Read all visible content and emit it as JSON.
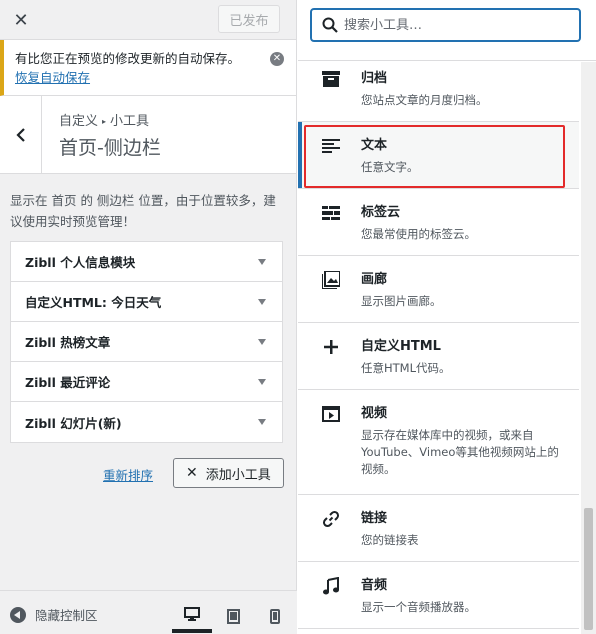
{
  "topbar": {
    "close": "✕",
    "publish_label": "已发布"
  },
  "notice": {
    "text": "有比您正在预览的修改更新的自动保存。",
    "link": "恢复自动保存"
  },
  "section": {
    "breadcrumb_parent": "自定义",
    "breadcrumb_child": "小工具",
    "title": "首页-侧边栏"
  },
  "description": "显示在 首页 的 侧边栏 位置，由于位置较多，建议使用实时预览管理！",
  "widgets": [
    {
      "label": "Zibll 个人信息模块"
    },
    {
      "label": "自定义HTML: 今日天气"
    },
    {
      "label": "Zibll 热榜文章"
    },
    {
      "label": "Zibll 最近评论"
    },
    {
      "label": "Zibll 幻灯片(新)"
    }
  ],
  "actions": {
    "reorder": "重新排序",
    "add": "添加小工具"
  },
  "footer": {
    "collapse": "隐藏控制区",
    "devices": [
      "desktop-icon",
      "tablet-icon",
      "mobile-icon"
    ],
    "active_device": "desktop"
  },
  "search": {
    "placeholder": "搜索小工具…",
    "value": ""
  },
  "available": [
    {
      "icon": "archive-icon",
      "title": "归档",
      "desc": "您站点文章的月度归档。"
    },
    {
      "icon": "text-icon",
      "title": "文本",
      "desc": "任意文字。",
      "selected": true
    },
    {
      "icon": "tag-cloud-icon",
      "title": "标签云",
      "desc": "您最常使用的标签云。"
    },
    {
      "icon": "gallery-icon",
      "title": "画廊",
      "desc": "显示图片画廊。"
    },
    {
      "icon": "plus-icon",
      "title": "自定义HTML",
      "desc": "任意HTML代码。"
    },
    {
      "icon": "video-icon",
      "title": "视频",
      "desc": "显示存在媒体库中的视频，或来自YouTube、Vimeo等其他视频网站上的视频。"
    },
    {
      "icon": "link-icon",
      "title": "链接",
      "desc": "您的链接表"
    },
    {
      "icon": "audio-icon",
      "title": "音频",
      "desc": "显示一个音频播放器。"
    }
  ],
  "colors": {
    "accent": "#2271b1",
    "highlight": "#e32a2a",
    "notice_border": "#dba617"
  }
}
